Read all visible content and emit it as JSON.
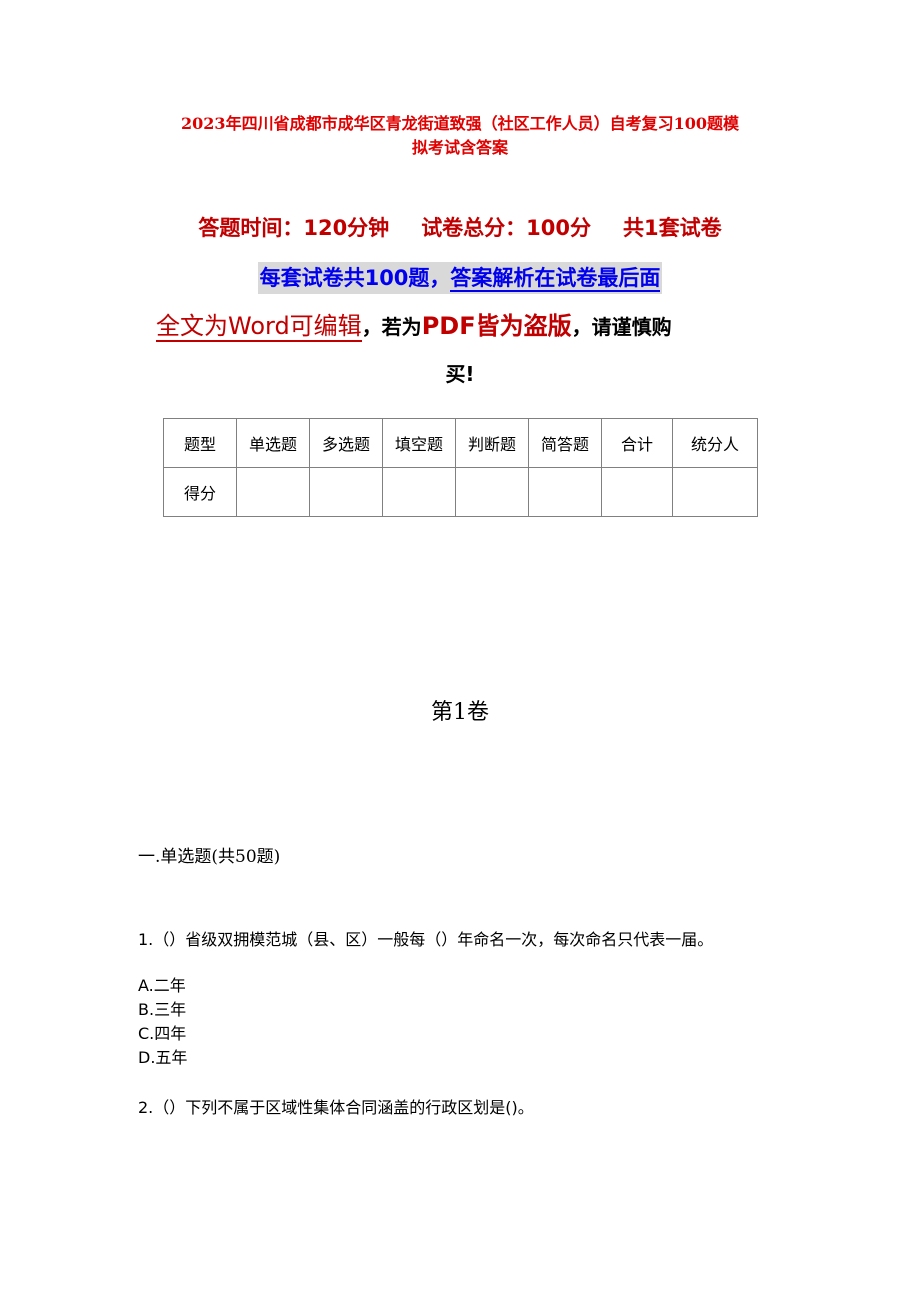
{
  "document": {
    "title_line1": "2023年四川省成都市成华区青龙街道致强（社区工作人员）自考复习100题模",
    "title_line2": "拟考试含答案",
    "meta": {
      "time": "答题时间：120分钟",
      "total": "试卷总分：100分",
      "sets": "共1套试卷"
    },
    "notice": {
      "part1": "每套试卷共100题，",
      "part2": "答案解析在试卷最后面"
    },
    "word_notice": {
      "red_underlined": "全文为Word可编辑",
      "comma1": "，若为",
      "pdf": "PDF皆为盗版",
      "rest": "，请谨慎购",
      "line2": "买!"
    },
    "score_table": {
      "headers": [
        "题型",
        "单选题",
        "多选题",
        "填空题",
        "判断题",
        "简答题",
        "合计",
        "统分人"
      ],
      "row_label": "得分",
      "row_values": [
        "",
        "",
        "",
        "",
        "",
        "",
        ""
      ]
    },
    "volume": "第1卷",
    "section": "一.单选题(共50题)",
    "questions": [
      {
        "text": "1.（）省级双拥模范城（县、区）一般每（）年命名一次，每次命名只代表一届。",
        "options": [
          "A.二年",
          "B.三年",
          "C.四年",
          "D.五年"
        ]
      },
      {
        "text": "2.（）下列不属于区域性集体合同涵盖的行政区划是()。",
        "options": []
      }
    ]
  }
}
